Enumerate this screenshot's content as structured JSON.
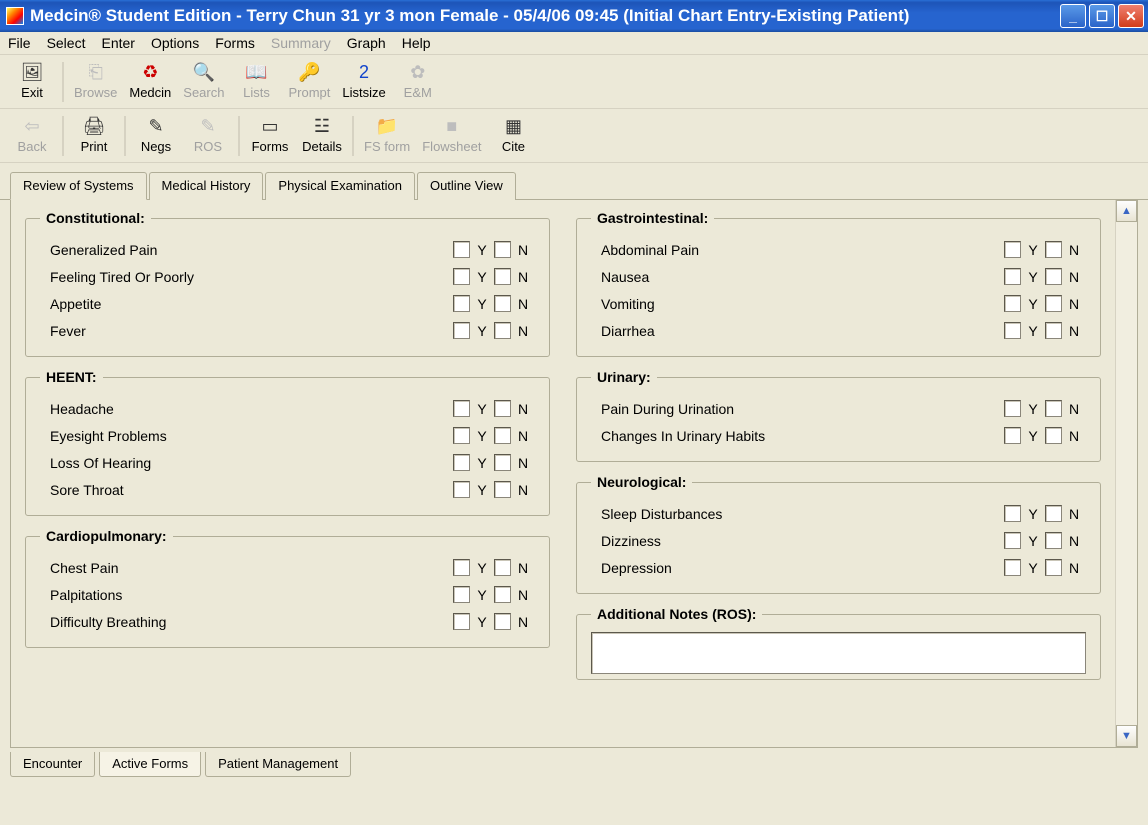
{
  "title": "Medcin® Student Edition - Terry Chun 31 yr 3 mon Female - 05/4/06 09:45 (Initial Chart Entry-Existing Patient)",
  "menu": [
    "File",
    "Select",
    "Enter",
    "Options",
    "Forms",
    "Summary",
    "Graph",
    "Help"
  ],
  "menu_disabled": [
    "Summary"
  ],
  "toolbar1": [
    {
      "label": "Exit",
      "icon": "🖼",
      "enabled": true
    },
    {
      "label": "Browse",
      "icon": "⎗",
      "enabled": false
    },
    {
      "label": "Medcin",
      "icon": "♻",
      "enabled": true
    },
    {
      "label": "Search",
      "icon": "🔍",
      "enabled": false
    },
    {
      "label": "Lists",
      "icon": "📖",
      "enabled": false
    },
    {
      "label": "Prompt",
      "icon": "🔑",
      "enabled": false
    },
    {
      "label": "Listsize",
      "icon": "2",
      "enabled": true
    },
    {
      "label": "E&M",
      "icon": "✿",
      "enabled": false
    }
  ],
  "toolbar2": [
    {
      "label": "Back",
      "icon": "⇦",
      "enabled": false
    },
    {
      "label": "Print",
      "icon": "🖨",
      "enabled": true
    },
    {
      "label": "Negs",
      "icon": "✎",
      "enabled": true
    },
    {
      "label": "ROS",
      "icon": "✎",
      "enabled": false
    },
    {
      "label": "Forms",
      "icon": "▭",
      "enabled": true
    },
    {
      "label": "Details",
      "icon": "☳",
      "enabled": true
    },
    {
      "label": "FS form",
      "icon": "📁",
      "enabled": false
    },
    {
      "label": "Flowsheet",
      "icon": "■",
      "enabled": false
    },
    {
      "label": "Cite",
      "icon": "▦",
      "enabled": true
    }
  ],
  "tabs": [
    "Review of Systems",
    "Medical History",
    "Physical Examination",
    "Outline View"
  ],
  "active_tab": "Review of Systems",
  "yn": {
    "y": "Y",
    "n": "N"
  },
  "sections_left": [
    {
      "title": "Constitutional:",
      "items": [
        "Generalized Pain",
        "Feeling Tired Or Poorly",
        "Appetite",
        "Fever"
      ]
    },
    {
      "title": "HEENT:",
      "items": [
        "Headache",
        "Eyesight Problems",
        "Loss Of Hearing",
        "Sore Throat"
      ]
    },
    {
      "title": "Cardiopulmonary:",
      "items": [
        "Chest Pain",
        "Palpitations",
        "Difficulty Breathing"
      ]
    }
  ],
  "sections_right": [
    {
      "title": "Gastrointestinal:",
      "items": [
        "Abdominal Pain",
        "Nausea",
        "Vomiting",
        "Diarrhea"
      ]
    },
    {
      "title": "Urinary:",
      "items": [
        "Pain During Urination",
        "Changes In Urinary Habits"
      ]
    },
    {
      "title": "Neurological:",
      "items": [
        "Sleep Disturbances",
        "Dizziness",
        "Depression"
      ]
    }
  ],
  "notes_title": "Additional Notes (ROS):",
  "bottom_tabs": [
    "Encounter",
    "Active Forms",
    "Patient Management"
  ],
  "bottom_active": "Active Forms"
}
